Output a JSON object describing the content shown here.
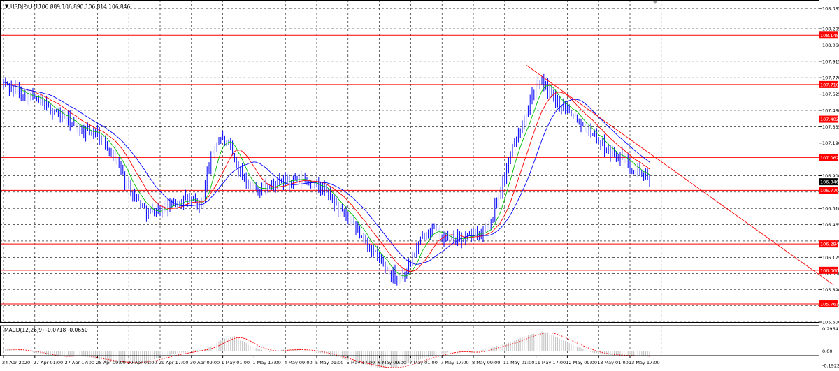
{
  "window": {
    "symbol_label": "USDJPY,H1",
    "ohlc_label": "106.889 106.890 106.814 106.846",
    "indicator_label": "MACD(12,26,9) -0.0718 -0.0650"
  },
  "colors": {
    "background": "#ffffff",
    "grid": "#000000",
    "candles": "#0000ff",
    "ma_fast": "#00c000",
    "ma_mid": "#ff0000",
    "ma_slow": "#0000ff",
    "level_line": "#ff0000",
    "level_tag_bg": "#ff0000",
    "level_tag_text": "#ffffff",
    "price_tag_bg": "#000000",
    "macd_hist": "#c0c0c0",
    "macd_signal": "#ff0000"
  },
  "chart_data": [
    {
      "type": "candlestick",
      "title": "USDJPY,H1",
      "ylim": [
        105.6,
        108.46
      ],
      "y_ticks": [
        108.385,
        108.205,
        108.06,
        107.915,
        107.77,
        107.625,
        107.48,
        107.335,
        107.19,
        106.9,
        106.755,
        106.61,
        106.465,
        106.32,
        106.175,
        106.03,
        105.89,
        105.745,
        105.6
      ],
      "x_tick_labels": [
        "24 Apr 2020",
        "27 Apr 01:00",
        "27 Apr 17:00",
        "28 Apr 09:00",
        "29 Apr 01:00",
        "29 Apr 17:00",
        "30 Apr 09:00",
        "1 May 01:00",
        "1 May 17:00",
        "4 May 09:00",
        "5 May 01:00",
        "5 May 17:00",
        "6 May 09:00",
        "7 May 01:00",
        "7 May 17:00",
        "8 May 09:00",
        "11 May 01:00",
        "11 May 17:00",
        "12 May 09:00",
        "13 May 01:00",
        "13 May 17:00"
      ],
      "anchor_points": [
        [
          0,
          107.72
        ],
        [
          1.2,
          107.55
        ],
        [
          2.5,
          107.3
        ],
        [
          3,
          107.28
        ],
        [
          3.6,
          107.05
        ],
        [
          3.9,
          106.85
        ],
        [
          4.2,
          106.72
        ],
        [
          4.6,
          106.57
        ],
        [
          5.2,
          106.62
        ],
        [
          5.8,
          106.7
        ],
        [
          6.3,
          106.62
        ],
        [
          6.6,
          107.05
        ],
        [
          6.9,
          107.25
        ],
        [
          7.2,
          107.15
        ],
        [
          7.6,
          106.92
        ],
        [
          8,
          106.78
        ],
        [
          8.5,
          106.8
        ],
        [
          9,
          106.85
        ],
        [
          9.6,
          106.86
        ],
        [
          10.2,
          106.78
        ],
        [
          10.6,
          106.65
        ],
        [
          11,
          106.5
        ],
        [
          11.6,
          106.3
        ],
        [
          12,
          106.15
        ],
        [
          12.3,
          106.05
        ],
        [
          12.6,
          106.0
        ],
        [
          12.85,
          106.05
        ],
        [
          13.2,
          106.25
        ],
        [
          13.6,
          106.45
        ],
        [
          14,
          106.35
        ],
        [
          14.5,
          106.33
        ],
        [
          15,
          106.38
        ],
        [
          15.4,
          106.42
        ],
        [
          15.6,
          106.55
        ],
        [
          15.9,
          106.8
        ],
        [
          16.2,
          107.1
        ],
        [
          16.6,
          107.4
        ],
        [
          16.9,
          107.65
        ],
        [
          17.25,
          107.73
        ],
        [
          17.6,
          107.55
        ],
        [
          18,
          107.52
        ],
        [
          18.4,
          107.38
        ],
        [
          18.8,
          107.28
        ],
        [
          19.2,
          107.15
        ],
        [
          19.6,
          107.08
        ],
        [
          20,
          107.0
        ],
        [
          20.3,
          106.95
        ],
        [
          20.6,
          106.85
        ]
      ],
      "macd_hist_anchors": [
        [
          0,
          0.03
        ],
        [
          0.8,
          0.0
        ],
        [
          1.6,
          -0.07
        ],
        [
          2.4,
          -0.06
        ],
        [
          3.2,
          -0.12
        ],
        [
          4,
          -0.16
        ],
        [
          4.6,
          -0.13
        ],
        [
          5.3,
          -0.05
        ],
        [
          6,
          0.0
        ],
        [
          6.5,
          0.04
        ],
        [
          7,
          0.16
        ],
        [
          7.4,
          0.2
        ],
        [
          7.9,
          0.06
        ],
        [
          8.5,
          -0.01
        ],
        [
          9,
          0.02
        ],
        [
          9.6,
          0.02
        ],
        [
          10.2,
          -0.03
        ],
        [
          10.8,
          -0.1
        ],
        [
          11.4,
          -0.17
        ],
        [
          12,
          -0.22
        ],
        [
          12.6,
          -0.21
        ],
        [
          13.2,
          -0.12
        ],
        [
          13.8,
          -0.05
        ],
        [
          14.4,
          0.0
        ],
        [
          15,
          -0.02
        ],
        [
          15.6,
          0.05
        ],
        [
          16.2,
          0.12
        ],
        [
          16.8,
          0.22
        ],
        [
          17.2,
          0.26
        ],
        [
          17.6,
          0.2
        ],
        [
          18.2,
          0.08
        ],
        [
          18.8,
          -0.02
        ],
        [
          19.4,
          -0.05
        ],
        [
          20,
          -0.06
        ],
        [
          20.6,
          -0.07
        ]
      ],
      "levels": [
        {
          "label": "108.148",
          "value": 108.148
        },
        {
          "label": "107.710",
          "value": 107.71
        },
        {
          "label": "107.402",
          "value": 107.402
        },
        {
          "label": "107.062",
          "value": 107.062
        },
        {
          "label": "106.770",
          "value": 106.77
        },
        {
          "label": "106.294",
          "value": 106.294
        },
        {
          "label": "106.060",
          "value": 106.06
        },
        {
          "label": "105.761",
          "value": 105.761
        }
      ],
      "current_price": {
        "label": "106.846",
        "value": 106.846
      },
      "trendline": {
        "from": [
          16.7,
          107.88
        ],
        "to": [
          26.5,
          105.93
        ]
      }
    },
    {
      "type": "macd",
      "title": "MACD(12,26,9) -0.0718 -0.0650",
      "ylim": [
        -0.06,
        0.34
      ],
      "y_tick_labels": [
        "0.2964",
        "0.00",
        "-0.1922"
      ],
      "y_tick_values": [
        0.2964,
        0.0,
        -0.1922
      ]
    }
  ]
}
